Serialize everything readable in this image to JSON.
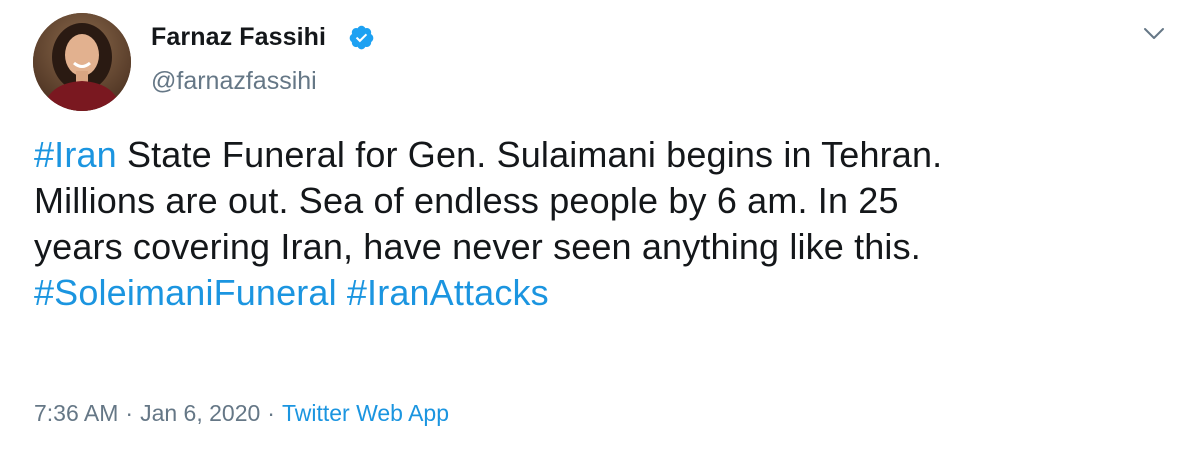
{
  "author": {
    "display_name": "Farnaz Fassihi",
    "handle": "@farnazfassihi",
    "verified": true
  },
  "tweet": {
    "segments": [
      {
        "text": "#Iran",
        "hashtag": true
      },
      {
        "text": " State Funeral for Gen. Sulaimani begins in Tehran.",
        "hashtag": false
      },
      {
        "text": "Millions are out. Sea of endless people by 6 am. In 25",
        "hashtag": false
      },
      {
        "text": "years covering Iran, have never seen anything like this.",
        "hashtag": false
      },
      {
        "text": "#SoleimaniFuneral",
        "hashtag": true
      },
      {
        "text": "#IranAttacks",
        "hashtag": true
      }
    ]
  },
  "meta": {
    "time": "7:36 AM",
    "separator": "·",
    "date": "Jan 6, 2020",
    "source": "Twitter Web App"
  },
  "icons": {
    "verified": "verified-badge-icon",
    "caret": "chevron-down-icon"
  },
  "colors": {
    "link": "#1b95e0",
    "text": "#14171a",
    "secondary": "#657786"
  }
}
